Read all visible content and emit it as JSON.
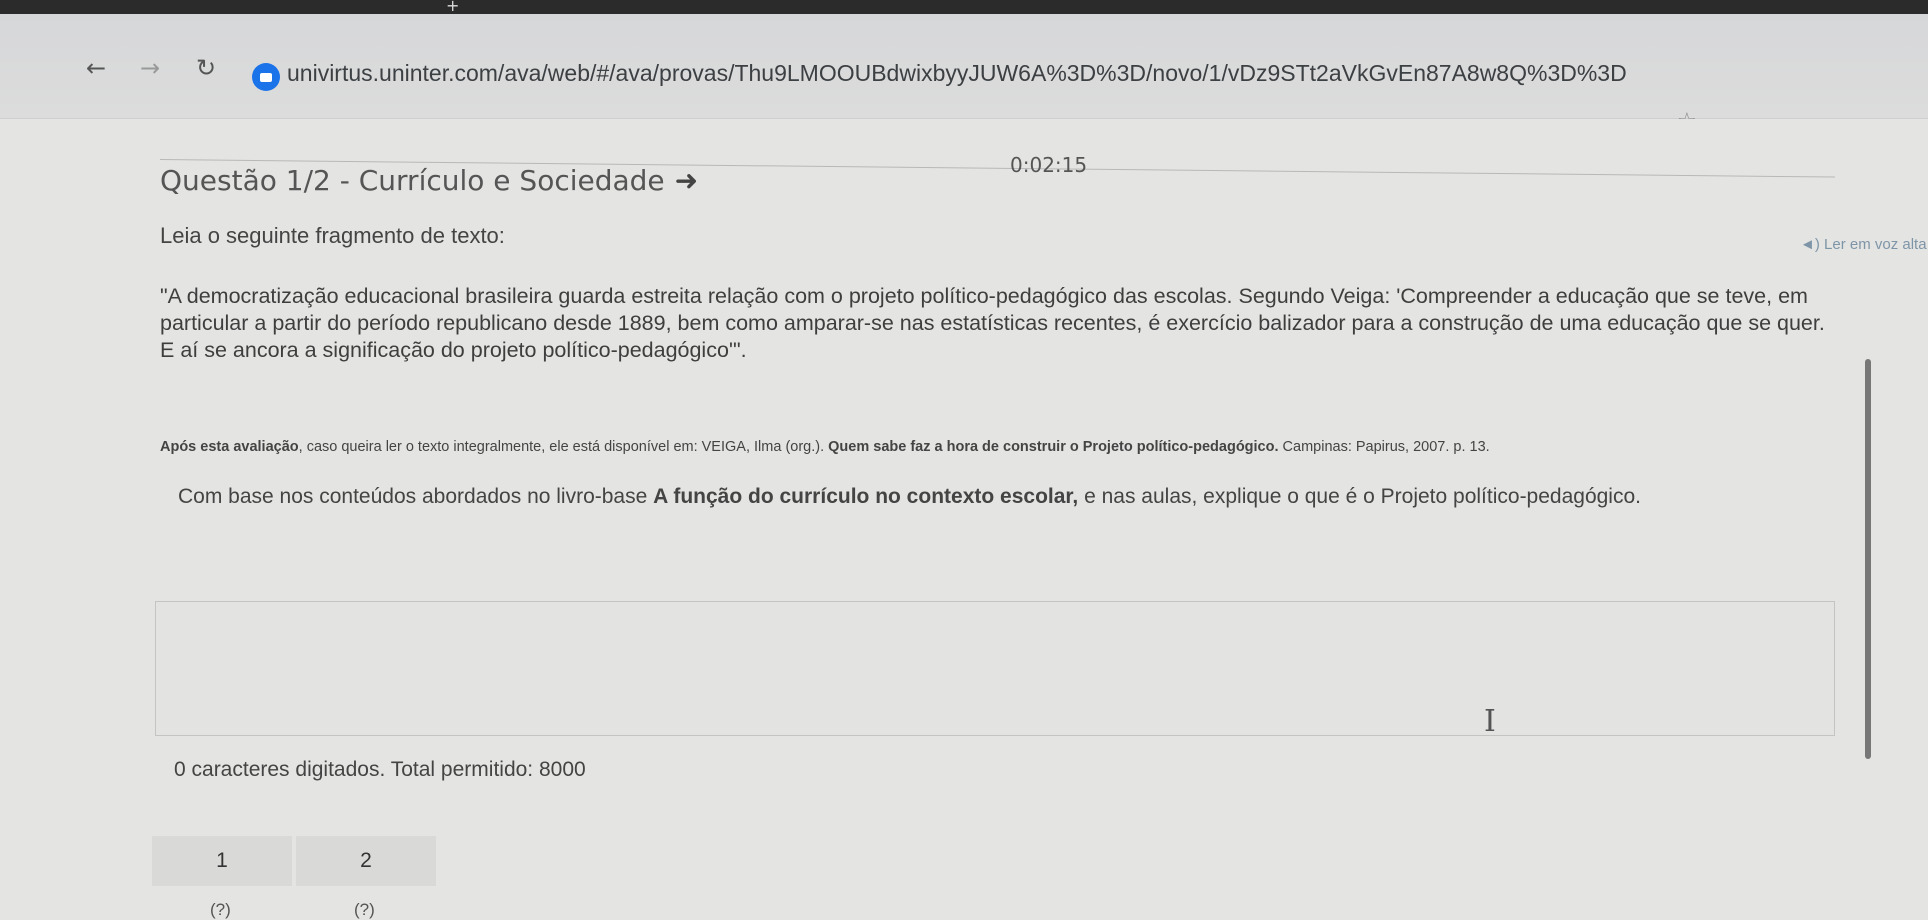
{
  "browser": {
    "url": "univirtus.uninter.com/ava/web/#/ava/provas/Thu9LMOOUBdwixbyyJUW6A%3D%3D/novo/1/vDz9STt2aVkGvEn87A8w8Q%3D%3D",
    "back_icon": "back-arrow-icon",
    "forward_icon": "forward-arrow-icon",
    "reload_icon": "reload-icon",
    "bookmark_icon": "star-icon"
  },
  "question": {
    "title": "Questão 1/2 - Currículo e Sociedade",
    "timer": "0:02:15",
    "read_aloud": "Ler em voz alta",
    "instruction": "Leia o seguinte fragmento de texto:",
    "quote": "\"A democratização educacional brasileira guarda estreita relação com o projeto político-pedagógico das escolas. Segundo Veiga: 'Compreender a educação que se teve, em particular a partir do período republicano desde 1889, bem como amparar-se nas estatísticas recentes, é exercício balizador para a construção de uma educação que se quer. E aí se ancora a significação do projeto político-pedagógico'\".",
    "source_prefix": "Após esta avaliação",
    "source_text": ", caso queira ler o texto integralmente, ele está disponível em: VEIGA, Ilma (org.). ",
    "source_bold": "Quem sabe faz a hora de construir o Projeto político-pedagógico.",
    "source_suffix": " Campinas: Papirus, 2007. p. 13.",
    "prompt_prefix": "Com base nos conteúdos abordados no livro-base ",
    "prompt_bold": "A função do currículo no contexto escolar,",
    "prompt_suffix": "  e nas aulas, explique o que é o Projeto político-pedagógico.",
    "char_count": "0 caracteres digitados. Total permitido: 8000"
  },
  "navigation": [
    {
      "number": "1",
      "status": "(?)"
    },
    {
      "number": "2",
      "status": "(?)"
    }
  ]
}
